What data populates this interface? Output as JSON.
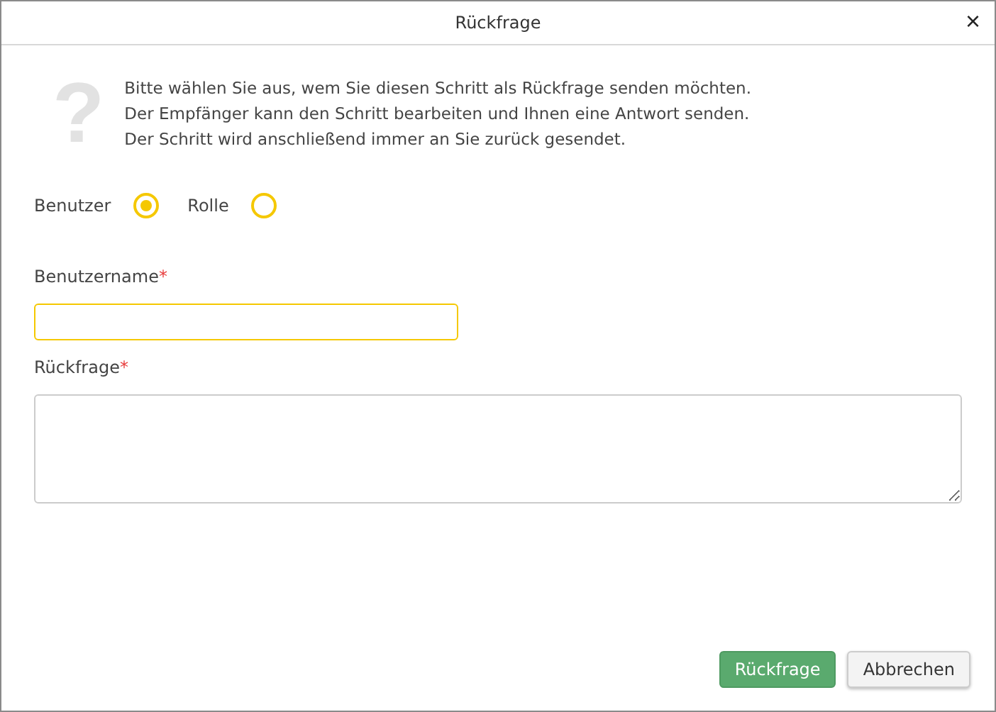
{
  "window": {
    "title": "Rückfrage",
    "close": "×"
  },
  "intro": {
    "icon": "?",
    "lines": [
      "Bitte wählen Sie aus, wem Sie diesen Schritt als Rückfrage senden möchten.",
      "Der Empfänger kann den Schritt bearbeiten und Ihnen eine Antwort senden.",
      "Der Schritt wird anschließend immer an Sie zurück gesendet."
    ]
  },
  "radios": [
    {
      "label": "Benutzer",
      "selected": true
    },
    {
      "label": "Rolle",
      "selected": false
    }
  ],
  "fields": [
    {
      "label": "Benutzername",
      "mark": "*",
      "kind": "input",
      "focused": true
    },
    {
      "label": "Rückfrage",
      "mark": "*",
      "kind": "textarea",
      "focused": false
    }
  ],
  "buttons": [
    {
      "label": "Rückfrage",
      "kind": "primary"
    },
    {
      "label": "Abbrechen",
      "kind": "secondary"
    }
  ]
}
